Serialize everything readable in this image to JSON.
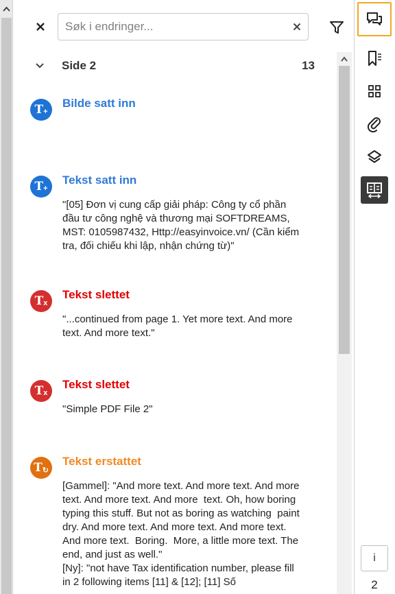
{
  "search": {
    "placeholder": "Søk i endringer...",
    "value": ""
  },
  "section": {
    "title": "Side 2",
    "count": "13"
  },
  "changes": [
    {
      "kind": "Bilde satt inn",
      "text": "",
      "icon": "text-insert-icon",
      "color": "#1e73d4"
    },
    {
      "kind": "Tekst satt inn",
      "text": "\"[05] Đơn vị cung cấp giải pháp: Công ty cổ phần đầu tư công nghệ và thương mại SOFTDREAMS, MST: 0105987432, Http://easyinvoice.vn/ (Cần kiểm tra, đối chiếu khi lập, nhận chứng từ)\"",
      "icon": "text-insert-icon",
      "color": "#1e73d4"
    },
    {
      "kind": "Tekst slettet",
      "text": "\"...continued from page 1. Yet more text. And more text. And more text.\"",
      "icon": "text-delete-icon",
      "color": "#d32f2f"
    },
    {
      "kind": "Tekst slettet",
      "text": "\"Simple PDF File 2\"",
      "icon": "text-delete-icon",
      "color": "#d32f2f"
    },
    {
      "kind": "Tekst erstattet",
      "text": "[Gammel]: \"And more text. And more text. And more text. And more text. And more  text. Oh, how boring typing this stuff. But not as boring as watching  paint dry. And more text. And more text. And more text. And more text.  Boring.  More, a little more text. The end, and just as well.\"\n[Ny]: \"not have Tax identification number, please fill in 2 following items [11] & [12]; [11] Số",
      "icon": "text-replace-icon",
      "color": "#e07010"
    }
  ],
  "toolbar": {
    "comments": "comments-icon",
    "bookmarks": "bookmark-list-icon",
    "thumbnails": "thumbnails-icon",
    "attachments": "paperclip-icon",
    "layers": "layers-icon",
    "compare": "compare-icon"
  },
  "info_label": "i",
  "page_number": "2"
}
